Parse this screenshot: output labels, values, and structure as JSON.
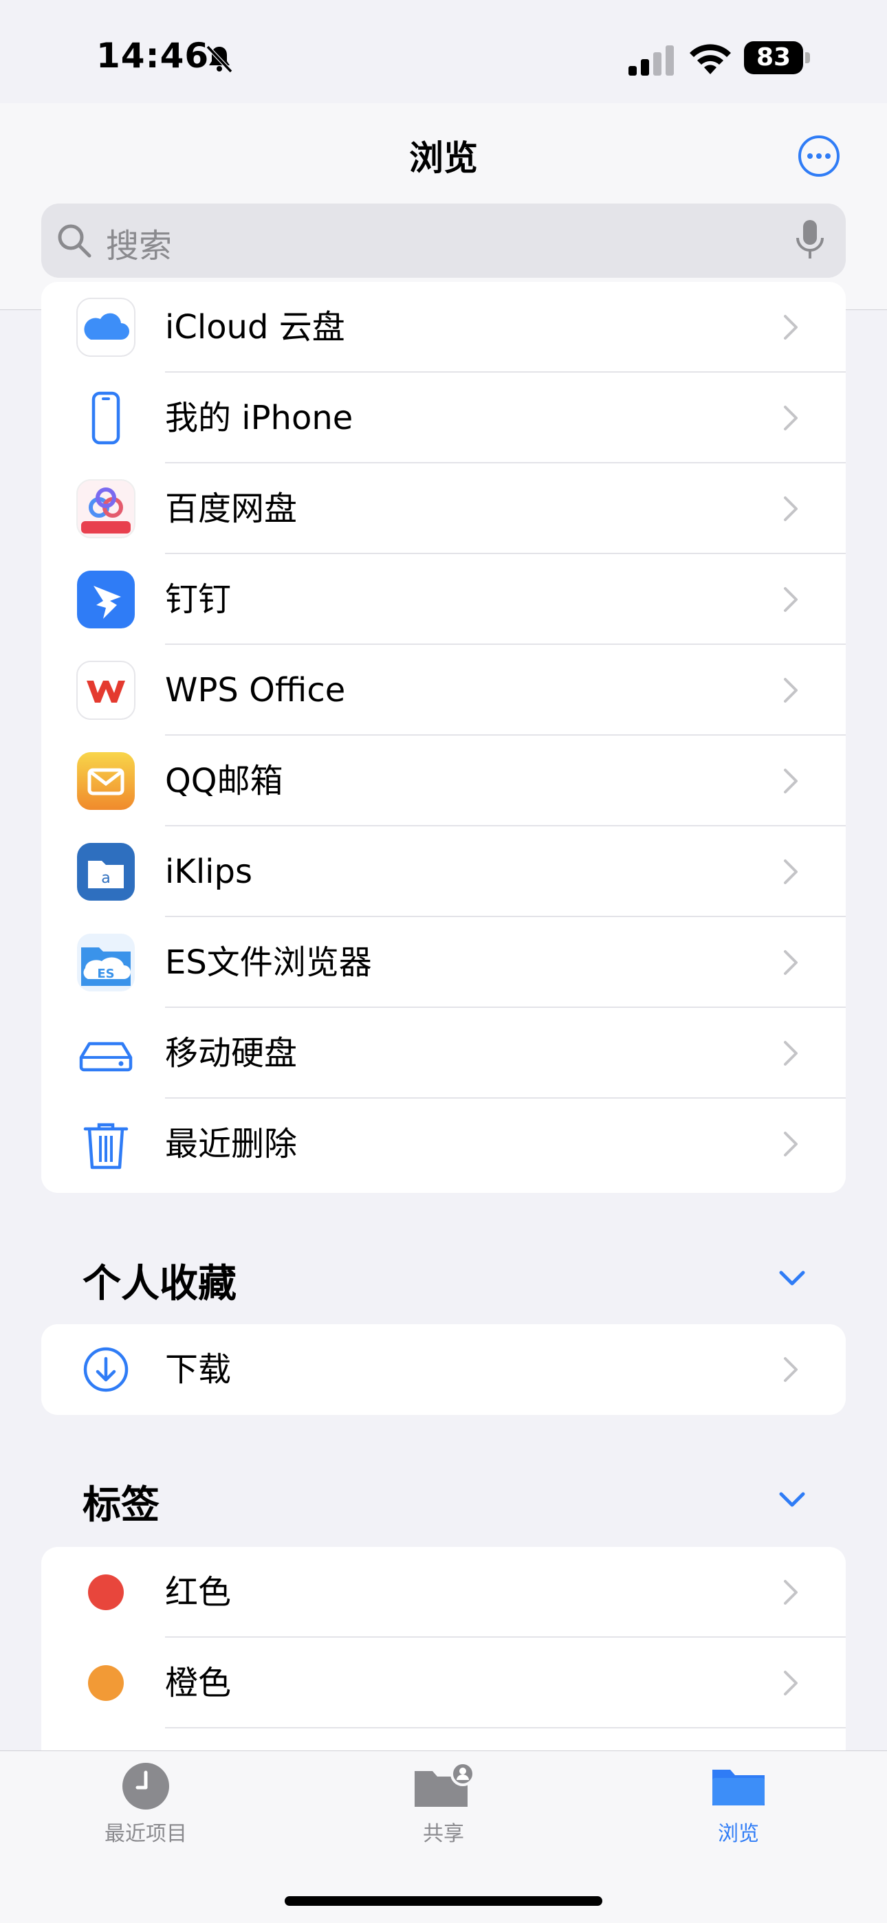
{
  "status_bar": {
    "time": "14:46",
    "battery": "83"
  },
  "nav": {
    "title": "浏览",
    "more_icon": "ellipsis-circle-icon"
  },
  "search": {
    "placeholder": "搜索"
  },
  "locations": [
    {
      "label": "iCloud 云盘",
      "icon": "icloud-icon"
    },
    {
      "label": "我的 iPhone",
      "icon": "iphone-icon"
    },
    {
      "label": "百度网盘",
      "icon": "baidu-netdisk-icon"
    },
    {
      "label": "钉钉",
      "icon": "dingtalk-icon"
    },
    {
      "label": "WPS Office",
      "icon": "wps-office-icon"
    },
    {
      "label": "QQ邮箱",
      "icon": "qq-mail-icon"
    },
    {
      "label": "iKlips",
      "icon": "iklips-icon"
    },
    {
      "label": "ES文件浏览器",
      "icon": "es-file-explorer-icon"
    },
    {
      "label": "移动硬盘",
      "icon": "external-drive-icon"
    },
    {
      "label": "最近删除",
      "icon": "trash-icon"
    }
  ],
  "favorites": {
    "title": "个人收藏",
    "items": [
      {
        "label": "下载",
        "icon": "download-icon"
      }
    ]
  },
  "tags": {
    "title": "标签",
    "items": [
      {
        "label": "红色",
        "color": "#e8463c"
      },
      {
        "label": "橙色",
        "color": "#f29a36"
      }
    ]
  },
  "tab_bar": [
    {
      "label": "最近项目",
      "icon": "clock-icon",
      "active": false
    },
    {
      "label": "共享",
      "icon": "shared-folder-icon",
      "active": false
    },
    {
      "label": "浏览",
      "icon": "folder-icon",
      "active": true
    }
  ],
  "colors": {
    "accent": "#2f7cf6",
    "tab_inactive": "#8a8a8e"
  }
}
